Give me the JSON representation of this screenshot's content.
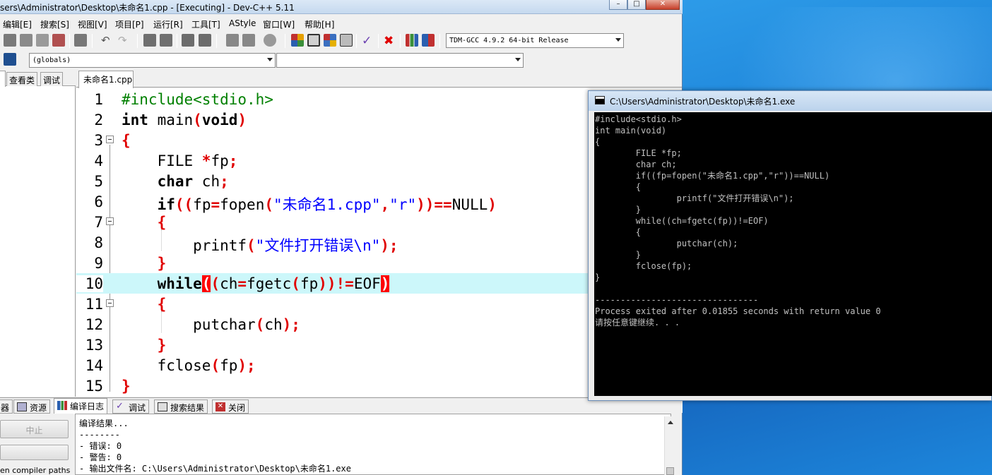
{
  "ide": {
    "title": "sers\\Administrator\\Desktop\\未命名1.cpp - [Executing] - Dev-C++ 5.11",
    "menu": [
      "编辑[E]",
      "搜索[S]",
      "视图[V]",
      "项目[P]",
      "运行[R]",
      "工具[T]",
      "AStyle",
      "窗口[W]",
      "帮助[H]"
    ],
    "compiler_select": "TDM-GCC 4.9.2 64-bit Release",
    "scope_select": "(globals)",
    "member_select": ""
  },
  "left_panel": {
    "tabs": [
      "查看类",
      "调试"
    ]
  },
  "editor": {
    "tab_label": "未命名1.cpp",
    "line_numbers": [
      "1",
      "2",
      "3",
      "4",
      "5",
      "6",
      "7",
      "8",
      "9",
      "10",
      "11",
      "12",
      "13",
      "14",
      "15"
    ],
    "lines": {
      "l1": "#include<stdio.h>",
      "l2_kw": "int",
      "l2_rest": " main",
      "l2_p1": "(",
      "l2_void": "void",
      "l2_p2": ")",
      "l3": "{",
      "l4_a": "    FILE ",
      "l4_star": "*",
      "l4_b": "fp",
      "l4_semi": ";",
      "l5_kw": "char",
      "l5_b": " ch",
      "l5_semi": ";",
      "l6_kw": "if",
      "l6_p": "((",
      "l6_fp": "fp",
      "l6_eq": "=",
      "l6_fn": "fopen",
      "l6_p2": "(",
      "l6_s1": "\"未命名1.cpp\"",
      "l6_c": ",",
      "l6_s2": "\"r\"",
      "l6_p3": "))==",
      "l6_null": "NULL",
      "l6_p4": ")",
      "l7": "{",
      "l8_fn": "printf",
      "l8_p": "(",
      "l8_s": "\"文件打开错误\\n\"",
      "l8_e": ");",
      "l9": "}",
      "l10_kw": "while",
      "l10_b1": "(",
      "l10_p": "(",
      "l10_ch": "ch",
      "l10_eq": "=",
      "l10_fn": "fgetc",
      "l10_p2": "(",
      "l10_fp": "fp",
      "l10_p3": "))!=",
      "l10_eof": "EOF",
      "l10_b2": ")",
      "l11": "{",
      "l12_fn": "putchar",
      "l12_p": "(",
      "l12_ch": "ch",
      "l12_e": ");",
      "l13": "}",
      "l14_fn": "fclose",
      "l14_p": "(",
      "l14_fp": "fp",
      "l14_e": ");",
      "l15": "}"
    }
  },
  "bottom": {
    "tabs": [
      "器",
      "资源",
      "编译日志",
      "调试",
      "搜索结果",
      "关闭"
    ],
    "abort_button": "中止",
    "compiler_paths_label": "en compiler paths",
    "log": "编译结果...\n--------\n- 错误: 0\n- 警告: 0\n- 输出文件名: C:\\Users\\Administrator\\Desktop\\未命名1.exe"
  },
  "console": {
    "title": "C:\\Users\\Administrator\\Desktop\\未命名1.exe",
    "output": "#include<stdio.h>\nint main(void)\n{\n        FILE *fp;\n        char ch;\n        if((fp=fopen(\"未命名1.cpp\",\"r\"))==NULL)\n        {\n                printf(\"文件打开错误\\n\");\n        }\n        while((ch=fgetc(fp))!=EOF)\n        {\n                putchar(ch);\n        }\n        fclose(fp);\n}\n\n--------------------------------\nProcess exited after 0.01855 seconds with return value 0\n请按任意键继续. . ."
  },
  "colors": {
    "keyword": "#000000",
    "preprocessor": "#008000",
    "punctuation": "#e00000",
    "string": "#0000ff",
    "current_line": "#ccf7fa",
    "desktop": "#1a7fd6"
  }
}
